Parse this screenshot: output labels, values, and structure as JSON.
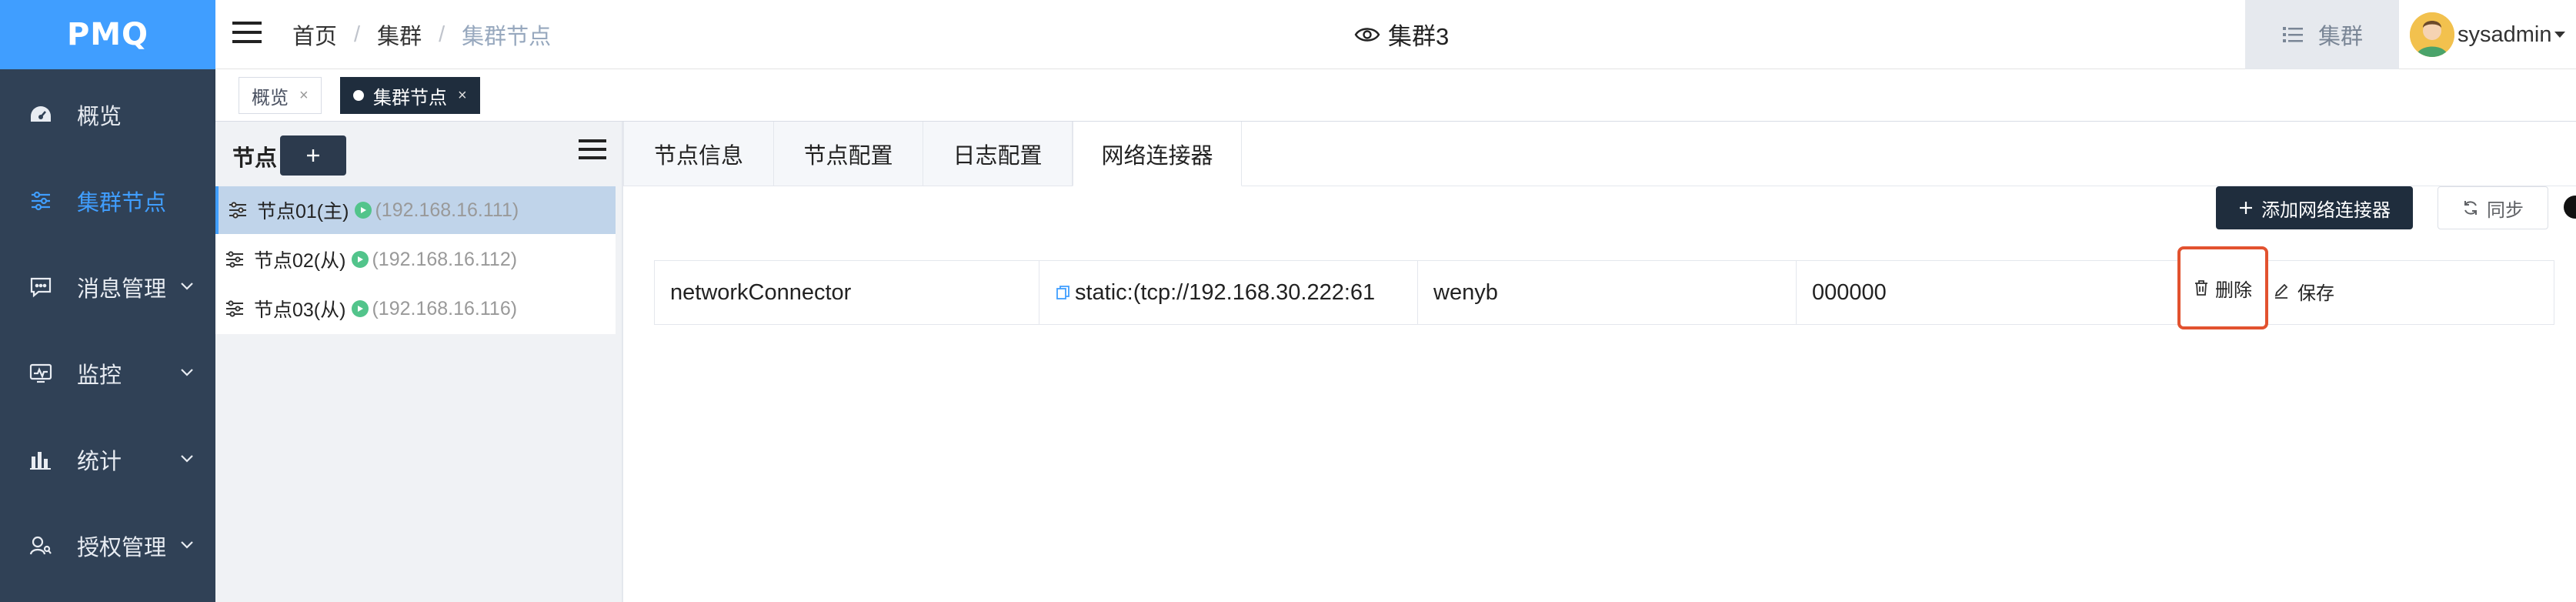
{
  "app": {
    "logo_text": "PMQ",
    "accent": "#409eff",
    "sidebar_bg": "#304156"
  },
  "sidebar": {
    "items": [
      {
        "label": "概览",
        "icon": "dashboard-icon",
        "active": false,
        "expandable": false
      },
      {
        "label": "集群节点",
        "icon": "sliders-icon",
        "active": true,
        "expandable": false
      },
      {
        "label": "消息管理",
        "icon": "message-icon",
        "active": false,
        "expandable": true
      },
      {
        "label": "监控",
        "icon": "monitor-icon",
        "active": false,
        "expandable": true
      },
      {
        "label": "统计",
        "icon": "bar-chart-icon",
        "active": false,
        "expandable": true
      },
      {
        "label": "授权管理",
        "icon": "user-auth-icon",
        "active": false,
        "expandable": true
      }
    ]
  },
  "header": {
    "breadcrumb": [
      "首页",
      "集群",
      "集群节点"
    ],
    "title": "集群3",
    "list_button": "集群",
    "username": "sysadmin"
  },
  "tags": [
    {
      "label": "概览",
      "active": false
    },
    {
      "label": "集群节点",
      "active": true
    }
  ],
  "nodes": {
    "title": "节点",
    "add_label": "+",
    "items": [
      {
        "name": "节点01(主)",
        "ip": "(192.168.16.111)",
        "selected": true
      },
      {
        "name": "节点02(从)",
        "ip": "(192.168.16.112)",
        "selected": false
      },
      {
        "name": "节点03(从)",
        "ip": "(192.168.16.116)",
        "selected": false
      }
    ]
  },
  "main": {
    "tabs": [
      "节点信息",
      "节点配置",
      "日志配置",
      "网络连接器"
    ],
    "active_tab": 3,
    "add_button": "添加网络连接器",
    "sync_button": "同步",
    "connector_row": {
      "name": "networkConnector",
      "uri": "static:(tcp://192.168.30.222:61",
      "user": "wenyb",
      "password": "000000",
      "delete_label": "删除",
      "save_label": "保存"
    }
  }
}
